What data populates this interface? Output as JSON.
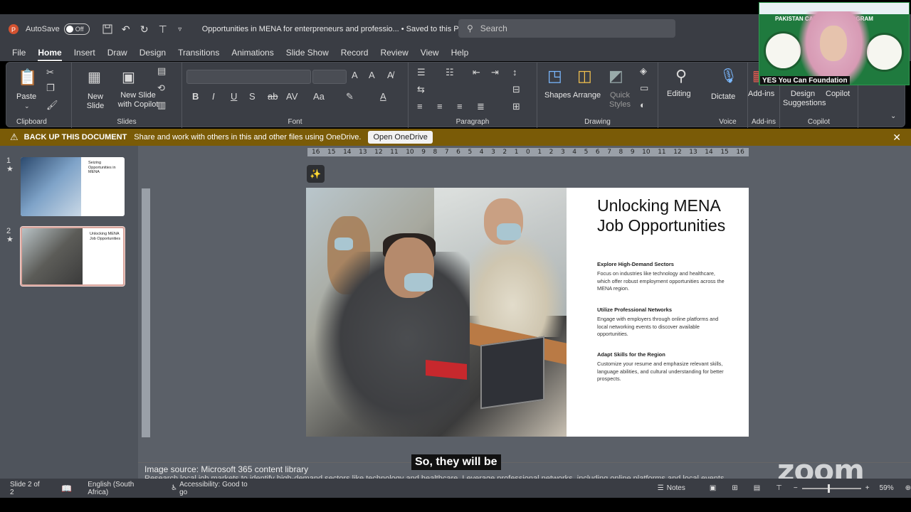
{
  "titlebar": {
    "autosave_label": "AutoSave",
    "autosave_state": "Off",
    "doc_title": "Opportunities in MENA for enterpreneurs and professio... • Saved to this PC",
    "search_placeholder": "Search"
  },
  "menu": [
    "File",
    "Home",
    "Insert",
    "Draw",
    "Design",
    "Transitions",
    "Animations",
    "Slide Show",
    "Record",
    "Review",
    "View",
    "Help"
  ],
  "ribbon": {
    "clipboard": {
      "label": "Clipboard",
      "paste": "Paste"
    },
    "slides": {
      "label": "Slides",
      "new_slide": "New Slide",
      "new_slide_copilot": "New Slide with Copilot"
    },
    "font": {
      "label": "Font"
    },
    "paragraph": {
      "label": "Paragraph"
    },
    "drawing": {
      "label": "Drawing",
      "shapes": "Shapes",
      "arrange": "Arrange",
      "quick_styles": "Quick Styles"
    },
    "editing": {
      "label": "Editing"
    },
    "voice": {
      "label": "Voice",
      "dictate": "Dictate"
    },
    "addins": {
      "label": "Add-ins",
      "addins_btn": "Add-ins"
    },
    "copilot": {
      "label": "Copilot",
      "design_suggestions": "Design Suggestions",
      "copilot_btn": "Copilot"
    }
  },
  "notification": {
    "title": "BACK UP THIS DOCUMENT",
    "message": "Share and work with others in this and other files using OneDrive.",
    "button": "Open OneDrive"
  },
  "thumbnails": [
    {
      "num": "1",
      "title": "Seizing Opportunities in MENA"
    },
    {
      "num": "2",
      "title": "Unlocking MENA Job Opportunities"
    }
  ],
  "ruler_ticks": [
    "16",
    "15",
    "14",
    "13",
    "12",
    "11",
    "10",
    "9",
    "8",
    "7",
    "6",
    "5",
    "4",
    "3",
    "2",
    "1",
    "0",
    "1",
    "2",
    "3",
    "4",
    "5",
    "6",
    "7",
    "8",
    "9",
    "10",
    "11",
    "12",
    "13",
    "14",
    "15",
    "16"
  ],
  "slide": {
    "title": "Unlocking MENA Job Opportunities",
    "sections": [
      {
        "heading": "Explore High-Demand Sectors",
        "body": "Focus on industries like technology and healthcare, which offer robust employment opportunities across the MENA region."
      },
      {
        "heading": "Utilize Professional Networks",
        "body": "Engage with employers through online platforms and local networking events to discover available opportunities."
      },
      {
        "heading": "Adapt Skills for the Region",
        "body": "Customize your resume and emphasize relevant skills, language abilities, and cultural understanding for better prospects."
      }
    ]
  },
  "notes": {
    "image_source": "Image source: Microsoft 365 content library",
    "line2": "Research local job markets to identify high-demand sectors like technology and healthcare. Leverage professional networks, including online platforms and local events"
  },
  "caption": "So, they will be",
  "zoom_logo": "zoom",
  "video": {
    "program_title": "PAKISTAN CAREER   ESS PROGRAM",
    "name": "YES You Can Foundation"
  },
  "status": {
    "slide_count": "Slide 2 of 2",
    "language": "English (South Africa)",
    "accessibility": "Accessibility: Good to go",
    "notes": "Notes",
    "zoom_pct": "59%"
  },
  "colors": {
    "notification_bg": "#7a5b07",
    "app_bg": "#3a3d44",
    "canvas_bg": "#5b6068"
  }
}
